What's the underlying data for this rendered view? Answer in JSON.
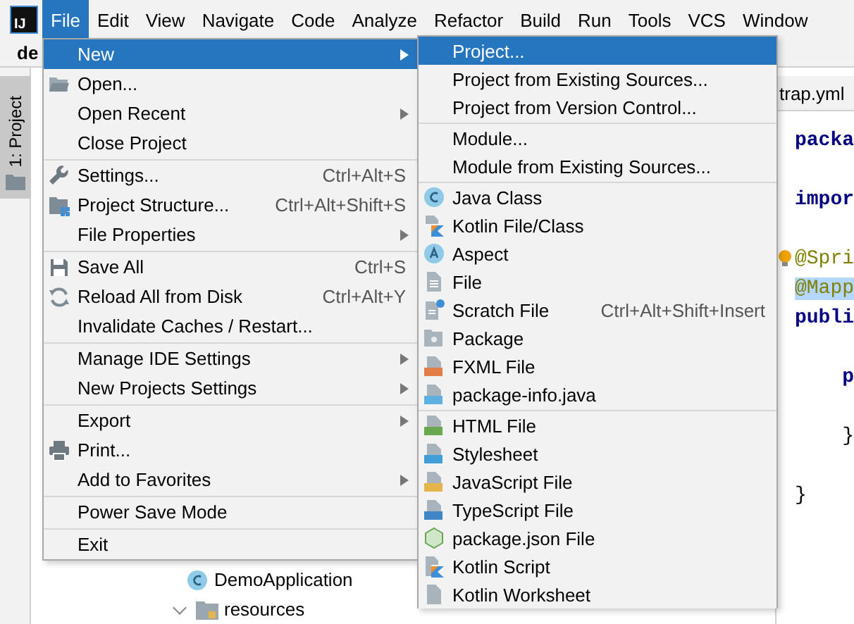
{
  "app_logo": {
    "text": "IJ"
  },
  "menubar": {
    "items": [
      {
        "label": "File",
        "selected": true
      },
      {
        "label": "Edit",
        "selected": false
      },
      {
        "label": "View",
        "selected": false
      },
      {
        "label": "Navigate",
        "selected": false
      },
      {
        "label": "Code",
        "selected": false
      },
      {
        "label": "Analyze",
        "selected": false
      },
      {
        "label": "Refactor",
        "selected": false
      },
      {
        "label": "Build",
        "selected": false
      },
      {
        "label": "Run",
        "selected": false
      },
      {
        "label": "Tools",
        "selected": false
      },
      {
        "label": "VCS",
        "selected": false
      },
      {
        "label": "Window",
        "selected": false
      }
    ]
  },
  "navbar": {
    "project": "de"
  },
  "side_strip": {
    "tab": "1: Project",
    "selected": true
  },
  "project_tree": {
    "items": [
      {
        "label": "DemoApplication",
        "kind": "class"
      },
      {
        "label": "resources",
        "kind": "folder",
        "expanded": true
      }
    ]
  },
  "editor": {
    "tab": "trap.yml",
    "lines": [
      {
        "text": "packa",
        "kind": "keyword",
        "highlighted": false,
        "bulb": false
      },
      {
        "kind": "blank"
      },
      {
        "text": "impor",
        "kind": "keyword",
        "highlighted": false,
        "bulb": false
      },
      {
        "kind": "blank"
      },
      {
        "text": "@Spri",
        "kind": "annotation",
        "highlighted": false,
        "bulb": true
      },
      {
        "text": "@Mapp",
        "kind": "annotation",
        "highlighted": true,
        "bulb": false
      },
      {
        "text": "publi",
        "kind": "keyword",
        "highlighted": false,
        "bulb": false
      },
      {
        "kind": "blank"
      },
      {
        "text": "    p",
        "kind": "keyword",
        "highlighted": false,
        "bulb": false
      },
      {
        "kind": "blank"
      },
      {
        "text": "    }",
        "kind": "plain",
        "highlighted": false,
        "bulb": false
      },
      {
        "kind": "blank"
      },
      {
        "text": "}",
        "kind": "plain",
        "highlighted": false,
        "bulb": false
      }
    ]
  },
  "file_menu": {
    "items": [
      {
        "label": "New",
        "kind": "none",
        "submenu": true,
        "selected": true,
        "separator_before": false
      },
      {
        "label": "Open...",
        "kind": "folder",
        "submenu": false,
        "selected": false,
        "separator_before": false
      },
      {
        "label": "Open Recent",
        "kind": "none",
        "submenu": true,
        "selected": false,
        "separator_before": false
      },
      {
        "label": "Close Project",
        "kind": "none",
        "submenu": false,
        "selected": false,
        "separator_before": false
      },
      {
        "label": "Settings...",
        "kind": "wrench",
        "shortcut": "Ctrl+Alt+S",
        "submenu": false,
        "selected": false,
        "separator_before": true
      },
      {
        "label": "Project Structure...",
        "kind": "structure",
        "shortcut": "Ctrl+Alt+Shift+S",
        "submenu": false,
        "selected": false,
        "separator_before": false
      },
      {
        "label": "File Properties",
        "kind": "none",
        "submenu": true,
        "selected": false,
        "separator_before": false
      },
      {
        "label": "Save All",
        "kind": "save",
        "shortcut": "Ctrl+S",
        "submenu": false,
        "selected": false,
        "separator_before": true
      },
      {
        "label": "Reload All from Disk",
        "kind": "reload",
        "shortcut": "Ctrl+Alt+Y",
        "submenu": false,
        "selected": false,
        "separator_before": false
      },
      {
        "label": "Invalidate Caches / Restart...",
        "kind": "none",
        "submenu": false,
        "selected": false,
        "separator_before": false
      },
      {
        "label": "Manage IDE Settings",
        "kind": "none",
        "submenu": true,
        "selected": false,
        "separator_before": true
      },
      {
        "label": "New Projects Settings",
        "kind": "none",
        "submenu": true,
        "selected": false,
        "separator_before": false
      },
      {
        "label": "Export",
        "kind": "none",
        "submenu": true,
        "selected": false,
        "separator_before": true
      },
      {
        "label": "Print...",
        "kind": "print",
        "submenu": false,
        "selected": false,
        "separator_before": false
      },
      {
        "label": "Add to Favorites",
        "kind": "none",
        "submenu": true,
        "selected": false,
        "separator_before": false
      },
      {
        "label": "Power Save Mode",
        "kind": "none",
        "submenu": false,
        "selected": false,
        "separator_before": true
      },
      {
        "label": "Exit",
        "kind": "none",
        "submenu": false,
        "selected": false,
        "separator_before": true
      }
    ]
  },
  "new_submenu": {
    "items": [
      {
        "label": "Project...",
        "kind": "none",
        "submenu": false,
        "selected": true,
        "separator_before": false
      },
      {
        "label": "Project from Existing Sources...",
        "kind": "none",
        "submenu": false,
        "selected": false,
        "separator_before": false
      },
      {
        "label": "Project from Version Control...",
        "kind": "none",
        "submenu": false,
        "selected": false,
        "separator_before": false
      },
      {
        "label": "Module...",
        "kind": "none",
        "submenu": false,
        "selected": false,
        "separator_before": true
      },
      {
        "label": "Module from Existing Sources...",
        "kind": "none",
        "submenu": false,
        "selected": false,
        "separator_before": false
      },
      {
        "label": "Java Class",
        "kind": "class",
        "submenu": false,
        "selected": false,
        "separator_before": true
      },
      {
        "label": "Kotlin File/Class",
        "kind": "kotlin",
        "submenu": false,
        "selected": false,
        "separator_before": false
      },
      {
        "label": "Aspect",
        "kind": "aspect",
        "submenu": false,
        "selected": false,
        "separator_before": false
      },
      {
        "label": "File",
        "kind": "file",
        "submenu": false,
        "selected": false,
        "separator_before": false
      },
      {
        "label": "Scratch File",
        "kind": "scratch",
        "shortcut": "Ctrl+Alt+Shift+Insert",
        "submenu": false,
        "selected": false,
        "separator_before": false
      },
      {
        "label": "Package",
        "kind": "package",
        "submenu": false,
        "selected": false,
        "separator_before": false
      },
      {
        "label": "FXML File",
        "kind": "fxml",
        "submenu": false,
        "selected": false,
        "separator_before": false
      },
      {
        "label": "package-info.java",
        "kind": "java",
        "submenu": false,
        "selected": false,
        "separator_before": false
      },
      {
        "label": "HTML File",
        "kind": "html",
        "submenu": false,
        "selected": false,
        "separator_before": true
      },
      {
        "label": "Stylesheet",
        "kind": "css",
        "submenu": false,
        "selected": false,
        "separator_before": false
      },
      {
        "label": "JavaScript File",
        "kind": "js",
        "submenu": false,
        "selected": false,
        "separator_before": false
      },
      {
        "label": "TypeScript File",
        "kind": "ts",
        "submenu": false,
        "selected": false,
        "separator_before": false
      },
      {
        "label": "package.json File",
        "kind": "nodejs",
        "submenu": false,
        "selected": false,
        "separator_before": false
      },
      {
        "label": "Kotlin Script",
        "kind": "kotlin-script",
        "submenu": false,
        "selected": false,
        "separator_before": false
      },
      {
        "label": "Kotlin Worksheet",
        "kind": "worksheet",
        "submenu": false,
        "selected": false,
        "separator_before": false
      }
    ]
  }
}
